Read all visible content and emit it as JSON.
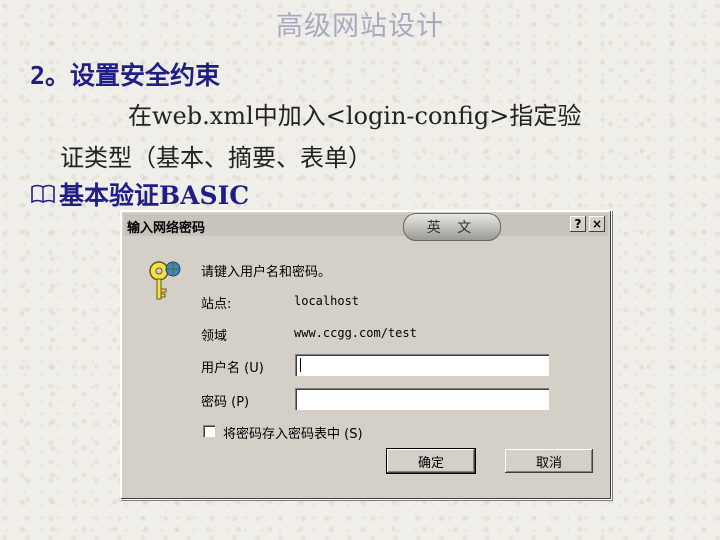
{
  "slide": {
    "title": "高级网站设计",
    "heading": "2。设置安全约束",
    "line1": "在web.xml中加入<login-config>指定验",
    "line2": "证类型（基本、摘要、表单）",
    "bullet": "基本验证BASIC"
  },
  "dialog": {
    "title": "输入网络密码",
    "ime_badge": "英 文",
    "help_label": "?",
    "close_label": "×",
    "prompt": "请键入用户名和密码。",
    "site_label": "站点:",
    "site_value": "localhost",
    "realm_label": "领域",
    "realm_value": "www.ccgg.com/test",
    "username_label": "用户名 (U)",
    "username_value": "",
    "password_label": "密码 (P)",
    "password_value": "",
    "save_password_label": "将密码存入密码表中 (S)",
    "save_password_checked": false,
    "ok_label": "确定",
    "cancel_label": "取消"
  }
}
